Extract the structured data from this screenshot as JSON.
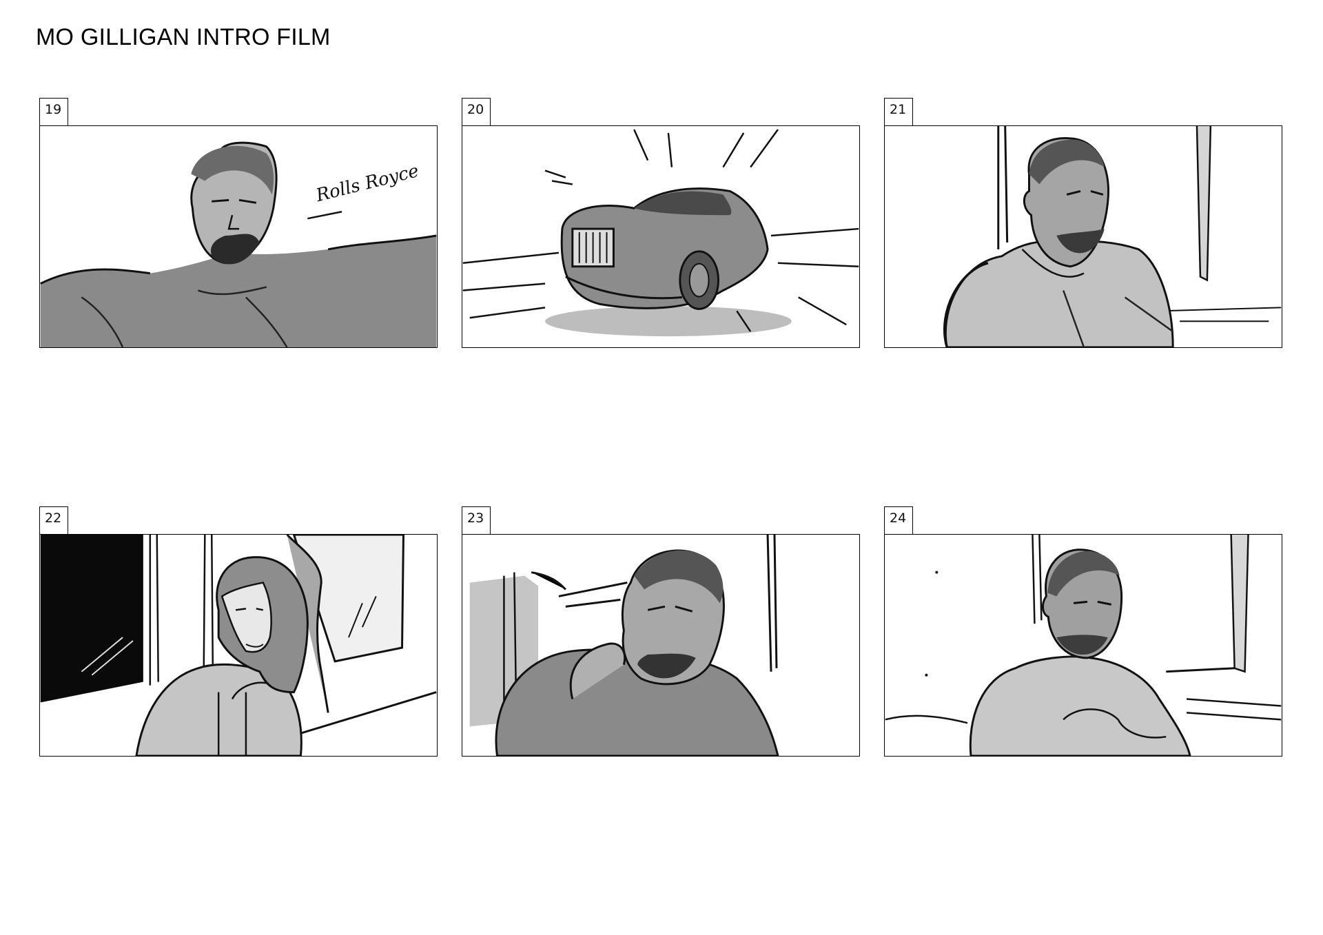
{
  "document": {
    "title": "MO GILLIGAN INTRO FILM"
  },
  "panels": [
    {
      "number": "19",
      "subject": "man-reclining",
      "annotation": "Rolls Royce"
    },
    {
      "number": "20",
      "subject": "car"
    },
    {
      "number": "21",
      "subject": "man-hoodie-looking-right"
    },
    {
      "number": "22",
      "subject": "woman-by-window"
    },
    {
      "number": "23",
      "subject": "man-thinking"
    },
    {
      "number": "24",
      "subject": "man-hoodie-looking-down"
    }
  ]
}
